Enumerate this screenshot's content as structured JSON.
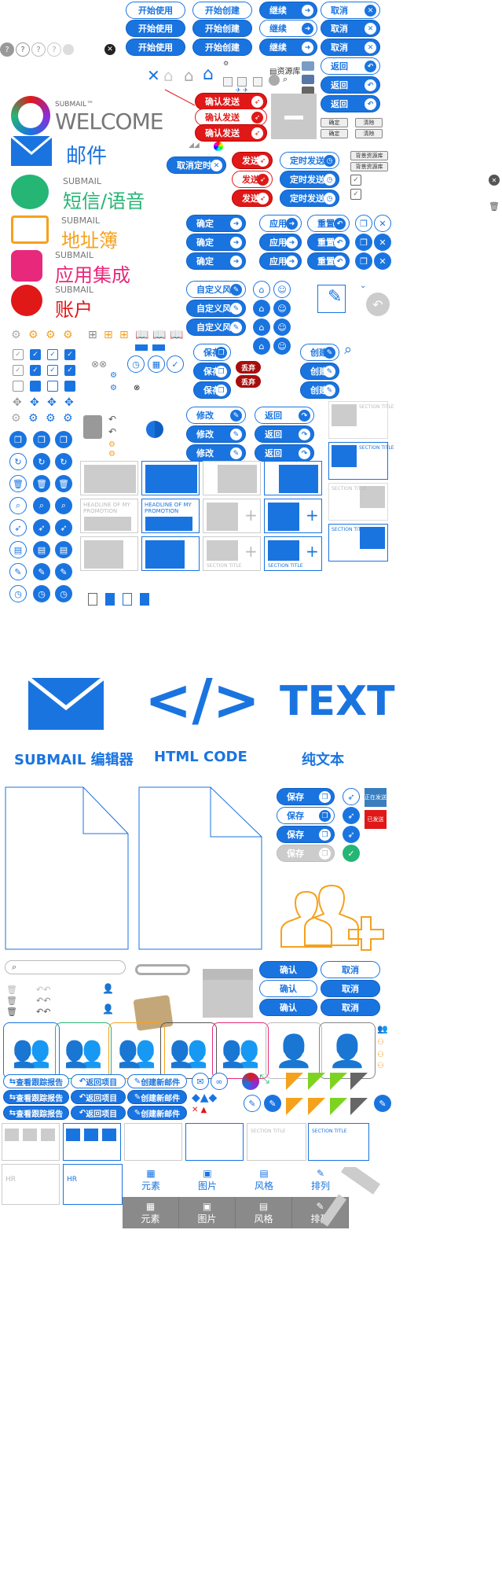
{
  "top_pills": {
    "start_use": "开始使用",
    "start_create": "开始创建",
    "continue": "继续",
    "cancel": "取消",
    "back": "返回"
  },
  "help_marks": [
    "?",
    "?",
    "?",
    "?"
  ],
  "resource_label": "资源库",
  "send": {
    "confirm_send": "确认发送",
    "send": "发送",
    "scheduled_send": "定时发送",
    "cancel_scheduled": "取消定时"
  },
  "small_buttons": {
    "confirm": "确定",
    "clear": "清除",
    "bg_library": "背景资源库"
  },
  "brand": {
    "submail_tm": "SUBMAIL™",
    "welcome": "WELCOME",
    "submail": "SUBMAIL",
    "mail": "邮件",
    "sms_voice": "短信/语音",
    "address_book": "地址簿",
    "app_integration": "应用集成",
    "account": "账户"
  },
  "actions": {
    "confirm": "确定",
    "apply": "应用",
    "reset": "重置",
    "custom_style": "自定义风格",
    "save": "保存",
    "discard": "丢弃",
    "create": "创建",
    "edit": "修改",
    "back": "返回"
  },
  "placeholders": {
    "headline_promo": "HEADLINE OF MY PROMOTION",
    "section_title": "SECTION TITLE",
    "section_body": "Lorem ipsum dolor sit amet, consect etuer adipiscing elit."
  },
  "editor_types": {
    "mail_code": "</>",
    "text_big": "TEXT",
    "submail_editor": "SUBMAIL 编辑器",
    "html_code": "HTML CODE",
    "plain_text": "纯文本"
  },
  "status_tags": {
    "sending": "正在发送",
    "sent": "已发送"
  },
  "confirm_cancel": {
    "confirm": "确认",
    "cancel": "取消"
  },
  "report_pills": {
    "view_report": "查看跟踪报告",
    "return_project": "返回项目",
    "create_mail": "创建新邮件"
  },
  "tabs": [
    "元素",
    "图片",
    "风格",
    "排列"
  ],
  "hr_label": "HR",
  "colors": {
    "primary": "#1a74e0",
    "red": "#e01818",
    "orange": "#f5a11c",
    "green": "#25b574",
    "pink": "#e8297b",
    "gray": "#6e6e6e"
  }
}
